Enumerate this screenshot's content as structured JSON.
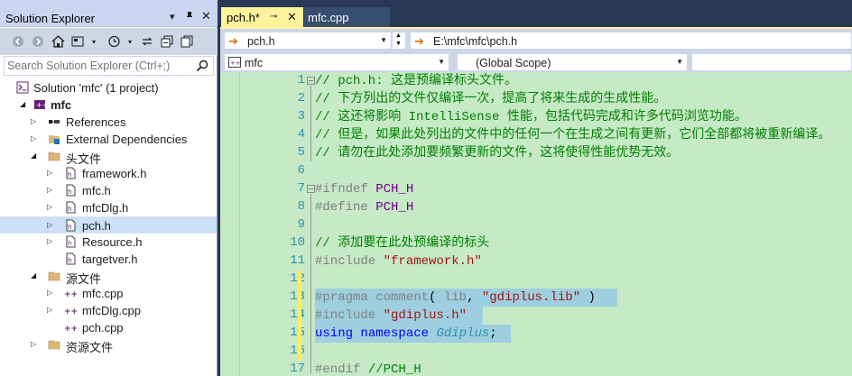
{
  "solution_explorer": {
    "title": "Solution Explorer",
    "search_placeholder": "Search Solution Explorer (Ctrl+;)",
    "tree": [
      {
        "label": "Solution 'mfc' (1 project)",
        "icon": "solution-icon"
      },
      {
        "label": "mfc",
        "icon": "project-icon"
      },
      {
        "label": "References",
        "icon": "references-icon"
      },
      {
        "label": "External Dependencies",
        "icon": "external-deps-icon"
      },
      {
        "label": "头文件",
        "icon": "folder-icon"
      },
      {
        "label": "framework.h",
        "icon": "header-file-icon"
      },
      {
        "label": "mfc.h",
        "icon": "header-file-icon"
      },
      {
        "label": "mfcDlg.h",
        "icon": "header-file-icon"
      },
      {
        "label": "pch.h",
        "icon": "header-file-icon"
      },
      {
        "label": "Resource.h",
        "icon": "header-file-icon"
      },
      {
        "label": "targetver.h",
        "icon": "header-file-icon"
      },
      {
        "label": "源文件",
        "icon": "folder-icon"
      },
      {
        "label": "mfc.cpp",
        "icon": "cpp-file-icon"
      },
      {
        "label": "mfcDlg.cpp",
        "icon": "cpp-file-icon"
      },
      {
        "label": "pch.cpp",
        "icon": "cpp-file-icon"
      },
      {
        "label": "资源文件",
        "icon": "folder-icon"
      }
    ]
  },
  "editor": {
    "tabs": [
      {
        "label": "pch.h*",
        "active": true
      },
      {
        "label": "mfc.cpp",
        "active": false
      }
    ],
    "nav_file": "pch.h",
    "nav_path": "E:\\mfc\\mfc\\pch.h",
    "project_combo": "mfc",
    "scope_combo": "(Global Scope)",
    "line_numbers": [
      "1",
      "2",
      "3",
      "4",
      "5",
      "6",
      "7",
      "8",
      "9",
      "10",
      "11",
      "12",
      "13",
      "14",
      "15",
      "16",
      "17"
    ],
    "code": {
      "l1": "// pch.h: 这是预编译标头文件。",
      "l2": "// 下方列出的文件仅编译一次，提高了将来生成的生成性能。",
      "l3": "// 这还将影响 IntelliSense 性能，包括代码完成和许多代码浏览功能。",
      "l4": "// 但是，如果此处列出的文件中的任何一个在生成之间有更新，它们全部都将被重新编译。",
      "l5": "// 请勿在此处添加要频繁更新的文件，这将使得性能优势无效。",
      "l7_kw": "#ifndef",
      "l7_id": "PCH_H",
      "l8_kw": "#define",
      "l8_id": "PCH_H",
      "l10": "// 添加要在此处预编译的标头",
      "l11_kw": "#include",
      "l11_str": "\"framework.h\"",
      "l13_kw": "#pragma",
      "l13_fn": "comment",
      "l13_p1": "( ",
      "l13_id": "lib",
      "l13_p2": ", ",
      "l13_str": "\"gdiplus.lib\"",
      "l13_p3": " )",
      "l14_kw": "#include",
      "l14_str": "\"gdiplus.h\"",
      "l15_kw1": "using",
      "l15_kw2": "namespace",
      "l15_ns": "Gdiplus",
      "l15_end": ";",
      "l17_kw": "#endif",
      "l17_cm": "//PCH_H"
    }
  },
  "colors": {
    "editor_background": "#c6e9c6",
    "selection": "#9dcfe0",
    "active_tab": "#fff29d",
    "chrome": "#293955"
  }
}
